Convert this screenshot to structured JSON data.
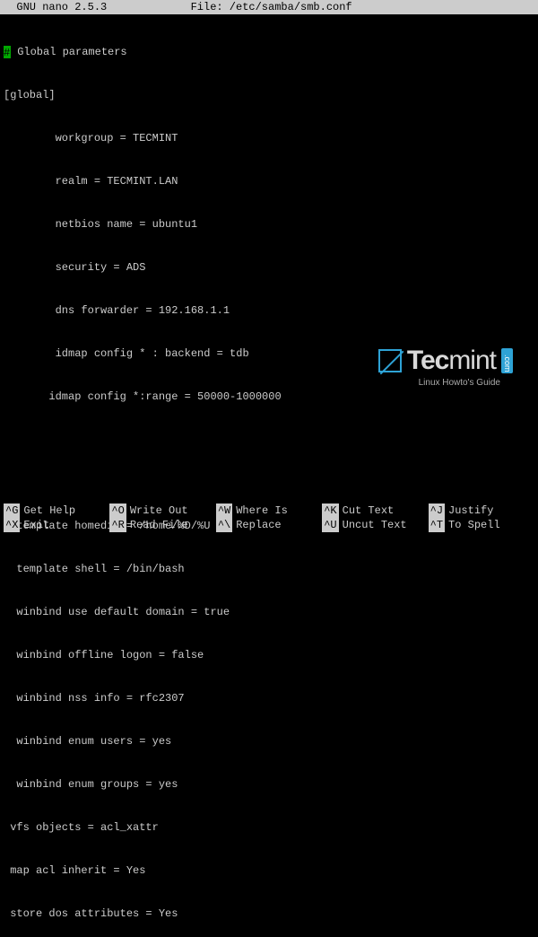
{
  "titlebar": {
    "app": "  GNU nano 2.5.3",
    "file": "File: /etc/samba/smb.conf"
  },
  "content": {
    "comment_marker": "#",
    "lines": [
      " Global parameters",
      "[global]",
      "        workgroup = TECMINT",
      "        realm = TECMINT.LAN",
      "        netbios name = ubuntu1",
      "        security = ADS",
      "        dns forwarder = 192.168.1.1",
      "        idmap config * : backend = tdb",
      "       idmap config *:range = 50000-1000000",
      "",
      "",
      "  template homedir = /home/%D/%U",
      "  template shell = /bin/bash",
      "  winbind use default domain = true",
      "  winbind offline logon = false",
      "  winbind nss info = rfc2307",
      "  winbind enum users = yes",
      "  winbind enum groups = yes",
      " vfs objects = acl_xattr",
      " map acl inherit = Yes",
      " store dos attributes = Yes"
    ]
  },
  "watermark": {
    "brand_bold": "Tec",
    "brand_light": "mint",
    "tld": ".com",
    "tagline": "Linux Howto's Guide"
  },
  "shortcuts": {
    "row1": [
      {
        "key": "^G",
        "label": "Get Help"
      },
      {
        "key": "^O",
        "label": "Write Out"
      },
      {
        "key": "^W",
        "label": "Where Is"
      },
      {
        "key": "^K",
        "label": "Cut Text"
      },
      {
        "key": "^J",
        "label": "Justify"
      }
    ],
    "row2": [
      {
        "key": "^X",
        "label": "Exit"
      },
      {
        "key": "^R",
        "label": "Read File"
      },
      {
        "key": "^\\",
        "label": "Replace"
      },
      {
        "key": "^U",
        "label": "Uncut Text"
      },
      {
        "key": "^T",
        "label": "To Spell"
      }
    ]
  }
}
